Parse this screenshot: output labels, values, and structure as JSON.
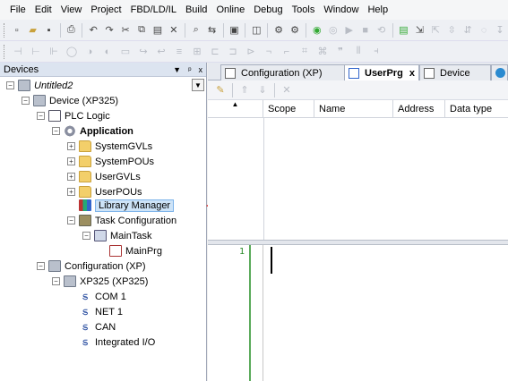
{
  "menu": [
    "File",
    "Edit",
    "View",
    "Project",
    "FBD/LD/IL",
    "Build",
    "Online",
    "Debug",
    "Tools",
    "Window",
    "Help"
  ],
  "devices_panel": {
    "title": "Devices",
    "pin": "ᵖ",
    "close": "x",
    "tree": [
      {
        "label": "Untitled2"
      },
      {
        "label": "Device (XP325)"
      },
      {
        "label": "PLC Logic"
      },
      {
        "label": "Application"
      },
      {
        "label": "SystemGVLs"
      },
      {
        "label": "SystemPOUs"
      },
      {
        "label": "UserGVLs"
      },
      {
        "label": "UserPOUs"
      },
      {
        "label": "Library Manager"
      },
      {
        "label": "Task Configuration"
      },
      {
        "label": "MainTask"
      },
      {
        "label": "MainPrg"
      },
      {
        "label": "Configuration (XP)"
      },
      {
        "label": "XP325 (XP325)"
      },
      {
        "label": "COM 1"
      },
      {
        "label": "NET 1"
      },
      {
        "label": "CAN"
      },
      {
        "label": "Integrated I/O"
      }
    ]
  },
  "tabs": [
    {
      "label": "Configuration (XP)",
      "close": ""
    },
    {
      "label": "UserPrg",
      "close": "x"
    },
    {
      "label": "Device",
      "close": ""
    }
  ],
  "var_columns": [
    "Scope",
    "Name",
    "Address",
    "Data type"
  ],
  "line_number": "1",
  "accent": "#e0201c"
}
